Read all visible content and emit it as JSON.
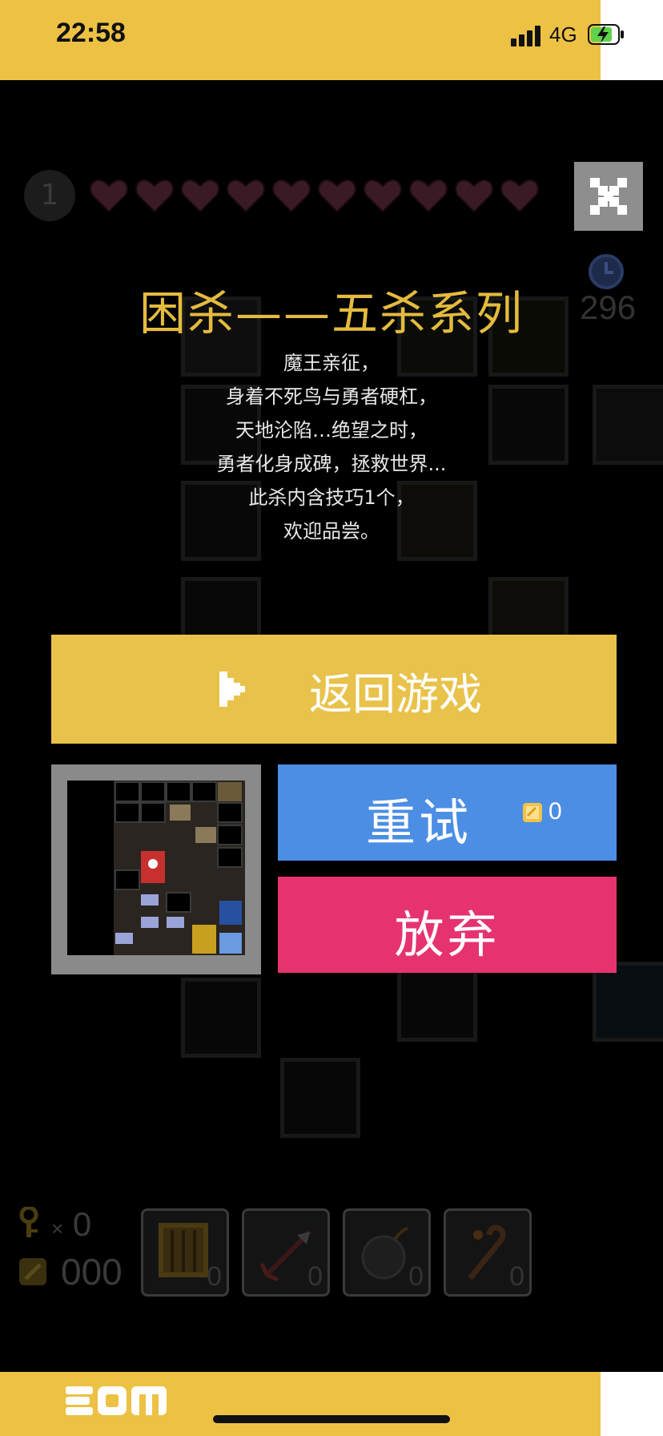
{
  "status": {
    "time": "22:58",
    "network": "4G"
  },
  "hud": {
    "level": "1",
    "hearts_count": 10,
    "timer": "296"
  },
  "dialog": {
    "title": "困杀——五杀系列",
    "description": [
      "魔王亲征，",
      "身着不死鸟与勇者硬杠，",
      "天地沦陷…绝望之时，",
      "勇者化身成碑，拯救世界...",
      "此杀内含技巧1个，",
      "欢迎品尝。"
    ],
    "return_label": "返回游戏",
    "retry_label": "重试",
    "retry_cost": "0",
    "giveup_label": "放弃"
  },
  "inventory": {
    "key_count": "0",
    "key_times": "×",
    "coin_count": "000",
    "items": [
      {
        "icon": "crate-icon",
        "count": "0"
      },
      {
        "icon": "arrow-icon",
        "count": "0"
      },
      {
        "icon": "bomb-icon",
        "count": "0"
      },
      {
        "icon": "staff-icon",
        "count": "0"
      }
    ]
  },
  "colors": {
    "brand_yellow": "#ecc144",
    "return_button": "#e8c24a",
    "retry_button": "#4b8ee4",
    "giveup_button": "#e63370",
    "title_gold": "#e4bb3e",
    "heart": "#3a1a24"
  }
}
